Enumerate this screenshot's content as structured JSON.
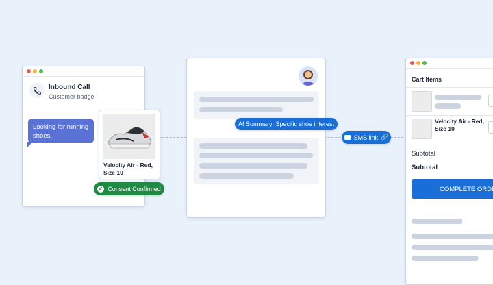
{
  "call": {
    "title": "Inbound Call",
    "subtitle": "Customer badge"
  },
  "bubble": {
    "text": "Looking for running shoes."
  },
  "product": {
    "name": "Velocity Air - Red, Size 10"
  },
  "consent": {
    "label": "Consent Confirmed",
    "color": "#1e8a44"
  },
  "summary": {
    "label": "AI Summary: Specific shoe interest"
  },
  "sms": {
    "label": "SMS link"
  },
  "cart": {
    "title": "Cart Items",
    "item_name": "Velocity Air - Red, Size 10",
    "subtotal_label": "Subtotal",
    "subtotal_bold": "Subtotal",
    "complete_label": "COMPLETE ORDER"
  },
  "colors": {
    "accent": "#1a6ed8",
    "bubble": "#5a72d6",
    "consent": "#1e8a44"
  }
}
